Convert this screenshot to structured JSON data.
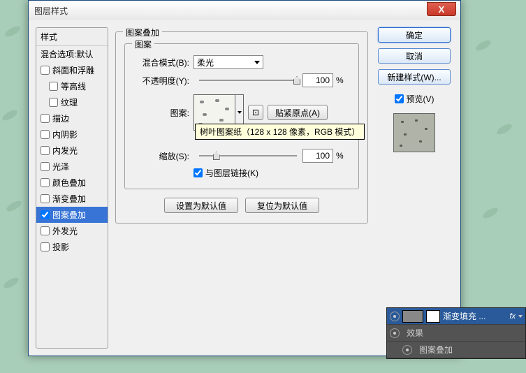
{
  "dialog": {
    "title": "图层样式",
    "close": "X"
  },
  "sidebar": {
    "header": "样式",
    "blend_default": "混合选项:默认",
    "items": {
      "bevel": "斜面和浮雕",
      "contour": "等高线",
      "texture": "纹理",
      "stroke": "描边",
      "inner_shadow": "内阴影",
      "inner_glow": "内发光",
      "satin": "光泽",
      "color_overlay": "颜色叠加",
      "gradient_overlay": "渐变叠加",
      "pattern_overlay": "图案叠加",
      "outer_glow": "外发光",
      "drop_shadow": "投影"
    }
  },
  "panel": {
    "title": "图案叠加",
    "inner_title": "图案",
    "blend_mode_label": "混合模式(B):",
    "blend_mode_value": "柔光",
    "opacity_label": "不透明度(Y):",
    "opacity_value": "100",
    "pattern_label": "图案:",
    "snap_origin": "贴紧原点(A)",
    "scale_label": "缩放(S):",
    "scale_value": "100",
    "link_label": "与图层链接(K)",
    "percent": "%",
    "tooltip": "树叶图案纸（128 x 128 像素，RGB 模式）",
    "make_default": "设置为默认值",
    "reset_default": "复位为默认值"
  },
  "buttons": {
    "ok": "确定",
    "cancel": "取消",
    "new_style": "新建样式(W)...",
    "preview": "预览(V)"
  },
  "layers": {
    "fill_layer": "渐变填充 ...",
    "fx": "fx",
    "effects": "效果",
    "pattern_overlay": "图案叠加"
  }
}
